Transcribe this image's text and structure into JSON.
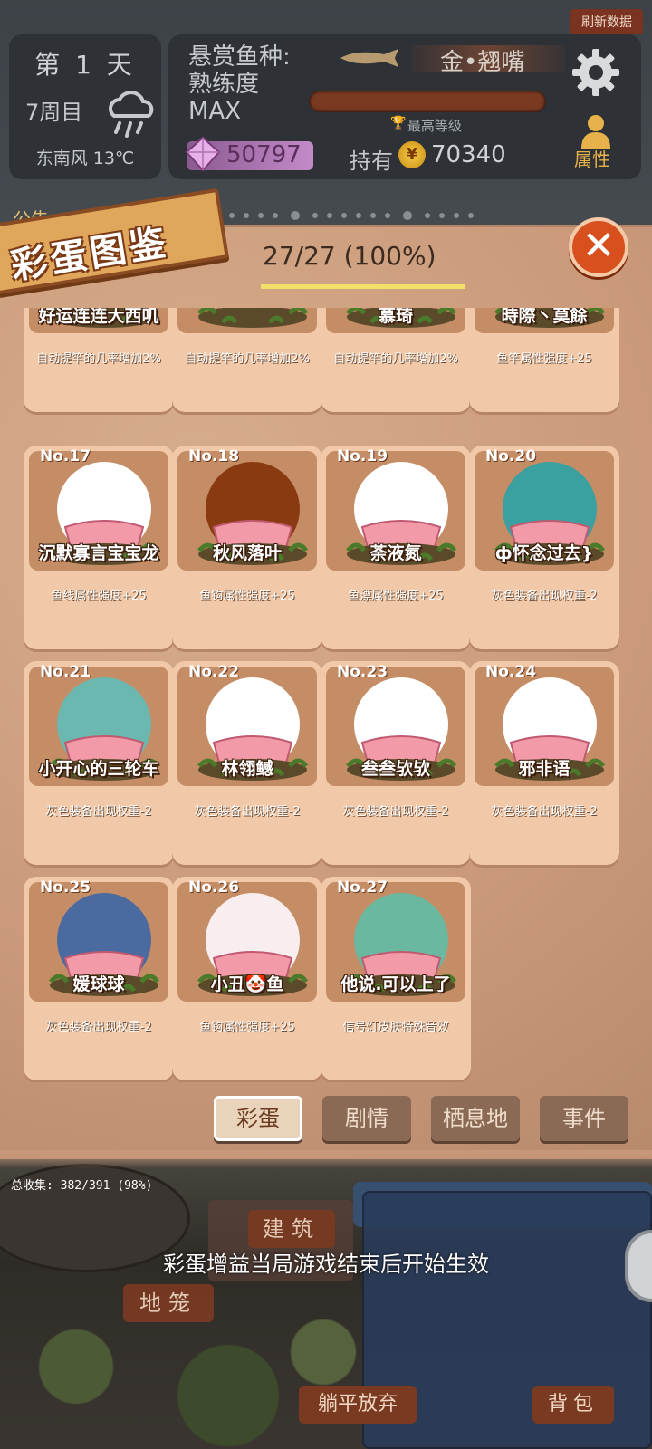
{
  "hud": {
    "refresh": "刷新数据",
    "day": "第 1 天",
    "week": "7周目",
    "wind": "东南风 13℃",
    "bounty_label": "悬赏鱼种:\n熟练度\nMAX",
    "bounty_fish": "金•翘嘴",
    "max_level": "最高等级",
    "gems": "50797",
    "hold_label": "持有",
    "coins": "70340",
    "coin_symbol": "¥",
    "attr_label": "属性",
    "notice": "公告",
    "progress_marker": "7"
  },
  "panel": {
    "title": "彩蛋图鉴",
    "count": "27/27 (100%)",
    "close": "✕"
  },
  "cards": [
    {
      "no": "",
      "name": "好运连连大西叽",
      "desc": "自动提竿的几率增加2%",
      "bg": "#8a3a2a"
    },
    {
      "no": "",
      "name": "",
      "desc": "自动提竿的几率增加2%",
      "bg": "#ffffff"
    },
    {
      "no": "",
      "name": "慕琦",
      "desc": "自动提竿的几率增加2%",
      "bg": "#6a4a3a"
    },
    {
      "no": "",
      "name": "時際丶莫餘",
      "desc": "鱼竿属性强度+25",
      "bg": "#b8a0d0"
    },
    {
      "no": "No.17",
      "name": "沉默寡言宝宝龙",
      "desc": "鱼线属性强度+25",
      "bg": "#ffffff"
    },
    {
      "no": "No.18",
      "name": "秋风落叶",
      "desc": "鱼钩属性强度+25",
      "bg": "#8a3a10"
    },
    {
      "no": "No.19",
      "name": "荼液氮",
      "desc": "鱼漂属性强度+25",
      "bg": "#ffffff"
    },
    {
      "no": "No.20",
      "name": "ф怀念过去}",
      "desc": "灰色装备出现权重-2",
      "bg": "#3aa0a0"
    },
    {
      "no": "No.21",
      "name": "小开心的三轮车",
      "desc": "灰色装备出现权重-2",
      "bg": "#6ab8b0"
    },
    {
      "no": "No.22",
      "name": "林翎鳡",
      "desc": "灰色装备出现权重-2",
      "bg": "#ffffff"
    },
    {
      "no": "No.23",
      "name": "叁叁欤欤",
      "desc": "灰色装备出现权重-2",
      "bg": "#ffffff"
    },
    {
      "no": "No.24",
      "name": "邪非语",
      "desc": "灰色装备出现权重-2",
      "bg": "#ffffff"
    },
    {
      "no": "No.25",
      "name": "媛球球",
      "desc": "灰色装备出现权重-2",
      "bg": "#4a6aa0"
    },
    {
      "no": "No.26",
      "name": "小丑🤡鱼",
      "desc": "鱼钩属性强度+25",
      "bg": "#f8eef0"
    },
    {
      "no": "No.27",
      "name": "他说.可以上了",
      "desc": "信号灯皮肤特殊音效",
      "bg": "#6ab8a0"
    }
  ],
  "tabs": {
    "easter": "彩蛋",
    "story": "剧情",
    "habitat": "栖息地",
    "event": "事件"
  },
  "bottom": {
    "collect": "总收集: 382/391 (98%)",
    "build": "建筑",
    "effect_note": "彩蛋增益当局游戏结束后开始生效",
    "cage": "地笼",
    "give_up": "躺平放弃",
    "bag": "背包"
  }
}
